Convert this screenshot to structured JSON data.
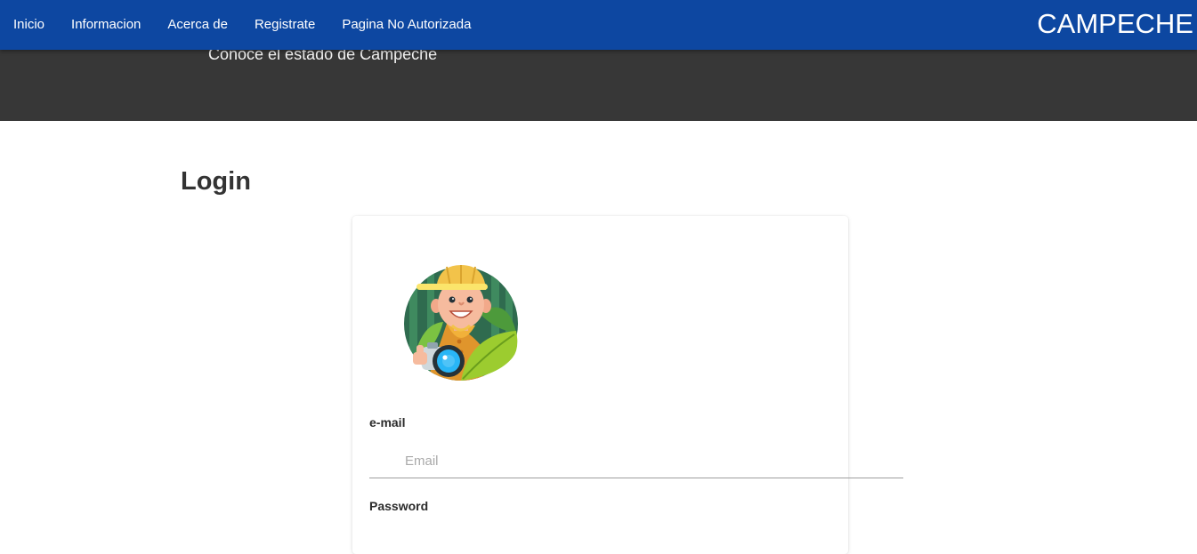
{
  "nav": {
    "links": [
      "Inicio",
      "Informacion",
      "Acerca de",
      "Registrate",
      "Pagina No Autorizada"
    ],
    "brand": "CAMPECHE"
  },
  "hero": {
    "subtitle": "Conoce el estado de Campeche"
  },
  "main": {
    "title": "Login",
    "avatar_icon": "explorer-avatar-icon",
    "form": {
      "email_label": "e-mail",
      "email_placeholder": "Email",
      "email_value": "",
      "password_label": "Password"
    }
  },
  "colors": {
    "navbar": "#0d47a1",
    "hero": "#373737",
    "background": "#ffffff"
  }
}
